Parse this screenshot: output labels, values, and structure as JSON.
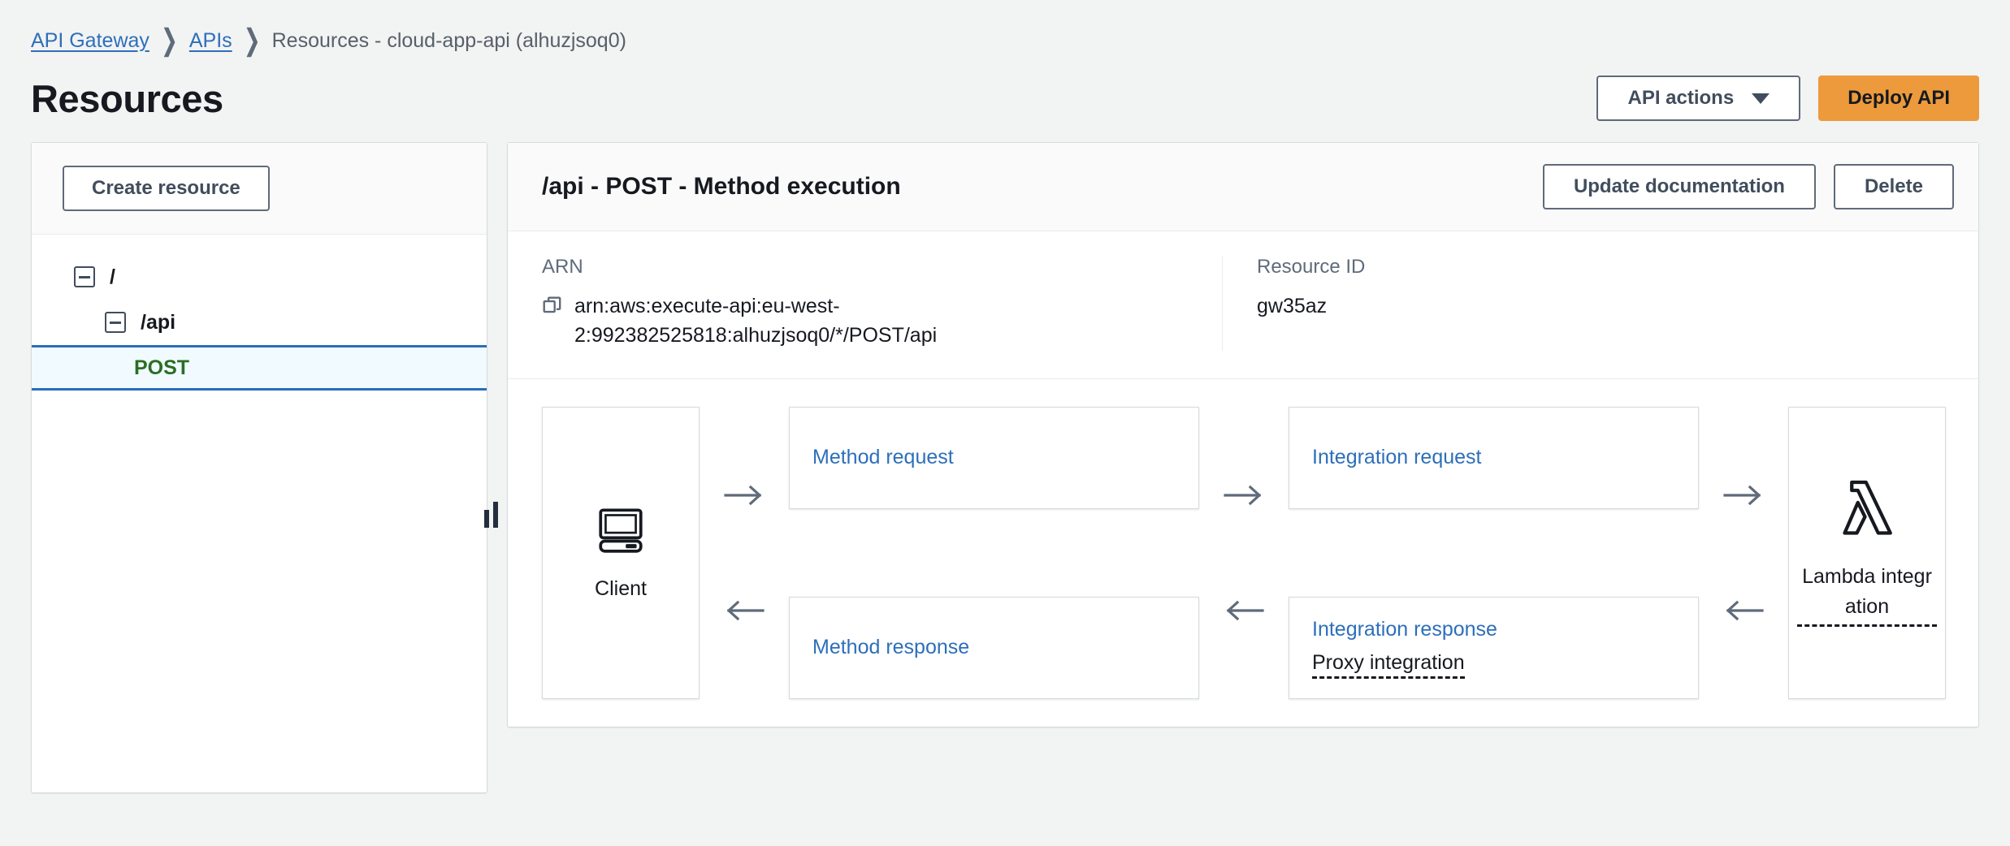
{
  "breadcrumb": {
    "items": [
      {
        "label": "API Gateway",
        "link": true
      },
      {
        "label": "APIs",
        "link": true
      },
      {
        "label": "Resources - cloud-app-api (alhuzjsoq0)",
        "link": false
      }
    ],
    "separator": "❯"
  },
  "page": {
    "title": "Resources"
  },
  "header_actions": {
    "api_actions_label": "API actions",
    "deploy_label": "Deploy API"
  },
  "sidebar": {
    "create_resource_label": "Create resource",
    "tree": [
      {
        "label": "/",
        "level": 0,
        "expander": true,
        "selected": false,
        "kind": "resource"
      },
      {
        "label": "/api",
        "level": 1,
        "expander": true,
        "selected": false,
        "kind": "resource"
      },
      {
        "label": "POST",
        "level": 2,
        "expander": false,
        "selected": true,
        "kind": "method"
      }
    ]
  },
  "panel": {
    "title": "/api - POST - Method execution",
    "update_documentation_label": "Update documentation",
    "delete_label": "Delete",
    "arn_label": "ARN",
    "arn_value": "arn:aws:execute-api:eu-west-2:992382525818:alhuzjsoq0/*/POST/api",
    "resource_id_label": "Resource ID",
    "resource_id_value": "gw35az"
  },
  "flow": {
    "client_label": "Client",
    "method_request_label": "Method request",
    "integration_request_label": "Integration request",
    "method_response_label": "Method response",
    "integration_response_label": "Integration response",
    "proxy_integration_label": "Proxy integration",
    "lambda_label": "Lambda integration",
    "arrow_forward": "→",
    "arrow_back": "←"
  },
  "colors": {
    "page_background": "#f2f3f3",
    "link_blue": "#2d6fba",
    "deploy_orange": "#ec9a3c",
    "method_post_green": "#2a6e22",
    "selected_row_background": "#f1faff",
    "selected_row_border": "#2a6ebb",
    "button_border": "#5f6b7a"
  }
}
